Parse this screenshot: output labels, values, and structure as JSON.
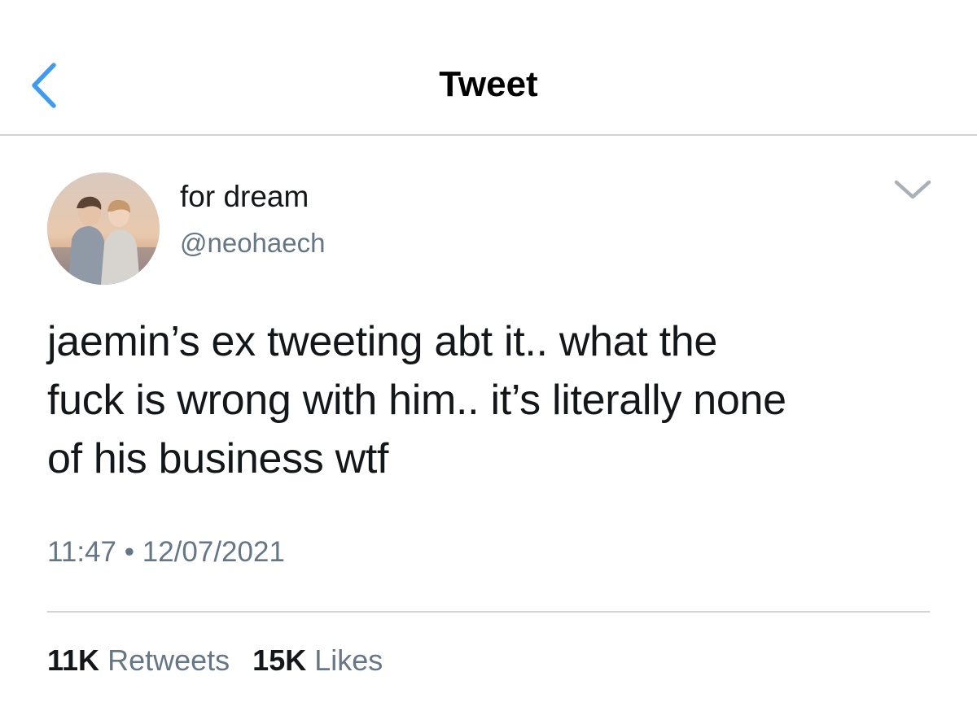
{
  "nav": {
    "title": "Tweet",
    "back_icon": "chevron-left-icon",
    "accent_color": "#3d9bf3"
  },
  "tweet": {
    "author": {
      "display_name": "for dream",
      "handle": "@neohaech",
      "avatar_icon": "profile-photo"
    },
    "menu_icon": "chevron-down-icon",
    "text_lines": [
      "jaemin’s ex tweeting abt it.. what the",
      "fuck is wrong with him.. it’s literally none",
      "of his business wtf"
    ],
    "time": "11:47",
    "separator": "•",
    "date": "12/07/2021",
    "stats": {
      "retweets_count": "11K",
      "retweets_label": "Retweets",
      "likes_count": "15K",
      "likes_label": "Likes"
    }
  },
  "colors": {
    "text_primary": "#14171a",
    "text_secondary": "#657786",
    "divider": "#d3d3d6",
    "background": "#ffffff"
  }
}
